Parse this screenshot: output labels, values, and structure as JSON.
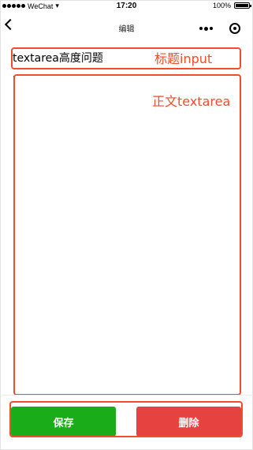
{
  "statusbar": {
    "carrier": "WeChat",
    "time": "17:20",
    "battery_text": "100%",
    "battery_level": 1.0
  },
  "navbar": {
    "title": "编辑"
  },
  "form": {
    "title_value": "textarea高度问题",
    "title_placeholder": "",
    "content_value": "",
    "content_placeholder": ""
  },
  "annotations": {
    "title_label": "标题input",
    "content_label": "正文textarea"
  },
  "buttons": {
    "save_label": "保存",
    "delete_label": "删除"
  },
  "colors": {
    "save": "#1aad19",
    "delete": "#e64340",
    "annotation": "#f04e2a"
  }
}
